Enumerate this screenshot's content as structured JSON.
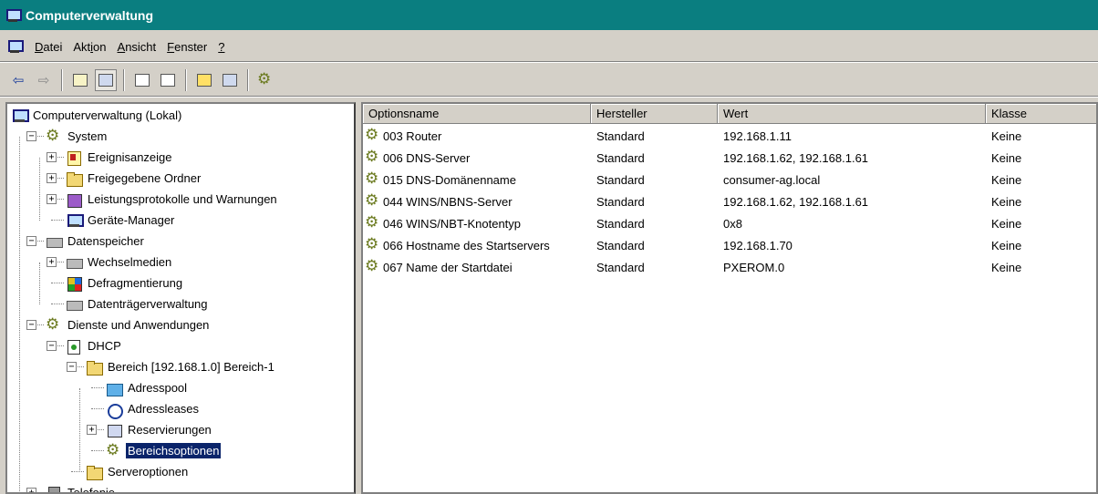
{
  "window": {
    "title": "Computerverwaltung"
  },
  "menu": {
    "items": [
      {
        "key": "D",
        "rest": "atei"
      },
      {
        "pre": "Akt",
        "key": "i",
        "rest": "on"
      },
      {
        "key": "A",
        "rest": "nsicht"
      },
      {
        "key": "F",
        "rest": "enster"
      },
      {
        "key": "?",
        "rest": ""
      }
    ]
  },
  "toolbar": {
    "buttons": [
      {
        "icon": "back-arrow-icon",
        "glyph": "⇦"
      },
      {
        "icon": "forward-arrow-icon",
        "glyph": "⇨"
      },
      {
        "icon": "up-folder-icon"
      },
      {
        "icon": "show-tree-icon"
      },
      {
        "icon": "refresh-icon"
      },
      {
        "icon": "export-list-icon"
      },
      {
        "icon": "help-icon"
      },
      {
        "icon": "console-tree-icon"
      },
      {
        "icon": "options-icon"
      }
    ]
  },
  "tree": [
    {
      "label": "Computerverwaltung (Lokal)",
      "icon": "pc"
    },
    {
      "label": "System",
      "icon": "gear"
    },
    {
      "label": "Ereignisanzeige",
      "icon": "event"
    },
    {
      "label": "Freigegebene Ordner",
      "icon": "folder"
    },
    {
      "label": "Leistungsprotokolle und Warnungen",
      "icon": "perf"
    },
    {
      "label": "Geräte-Manager",
      "icon": "pc"
    },
    {
      "label": "Datenspeicher",
      "icon": "disk"
    },
    {
      "label": "Wechselmedien",
      "icon": "disk"
    },
    {
      "label": "Defragmentierung",
      "icon": "defrag"
    },
    {
      "label": "Datenträgerverwaltung",
      "icon": "disk"
    },
    {
      "label": "Dienste und Anwendungen",
      "icon": "gear"
    },
    {
      "label": "DHCP",
      "icon": "dhcp"
    },
    {
      "label": "Bereich [192.168.1.0] Bereich-1",
      "icon": "folder"
    },
    {
      "label": "Adresspool",
      "icon": "pool"
    },
    {
      "label": "Adressleases",
      "icon": "clock"
    },
    {
      "label": "Reservierungen",
      "icon": "res"
    },
    {
      "label": "Bereichsoptionen",
      "icon": "gear",
      "selected": true
    },
    {
      "label": "Serveroptionen",
      "icon": "folder"
    },
    {
      "label": "Telefonie",
      "icon": "tel"
    }
  ],
  "list": {
    "columns": [
      "Optionsname",
      "Hersteller",
      "Wert",
      "Klasse"
    ],
    "rows": [
      {
        "name": "003 Router",
        "vendor": "Standard",
        "value": "192.168.1.11",
        "class": "Keine"
      },
      {
        "name": "006 DNS-Server",
        "vendor": "Standard",
        "value": "192.168.1.62, 192.168.1.61",
        "class": "Keine"
      },
      {
        "name": "015 DNS-Domänenname",
        "vendor": "Standard",
        "value": "consumer-ag.local",
        "class": "Keine"
      },
      {
        "name": "044 WINS/NBNS-Server",
        "vendor": "Standard",
        "value": "192.168.1.62, 192.168.1.61",
        "class": "Keine"
      },
      {
        "name": "046 WINS/NBT-Knotentyp",
        "vendor": "Standard",
        "value": "0x8",
        "class": "Keine"
      },
      {
        "name": "066 Hostname des Startservers",
        "vendor": "Standard",
        "value": "192.168.1.70",
        "class": "Keine"
      },
      {
        "name": "067 Name der Startdatei",
        "vendor": "Standard",
        "value": "PXEROM.0",
        "class": "Keine"
      }
    ]
  },
  "colors": {
    "titlebar": "#0a7e80",
    "selection": "#0a246a",
    "face": "#d4d0c8"
  }
}
